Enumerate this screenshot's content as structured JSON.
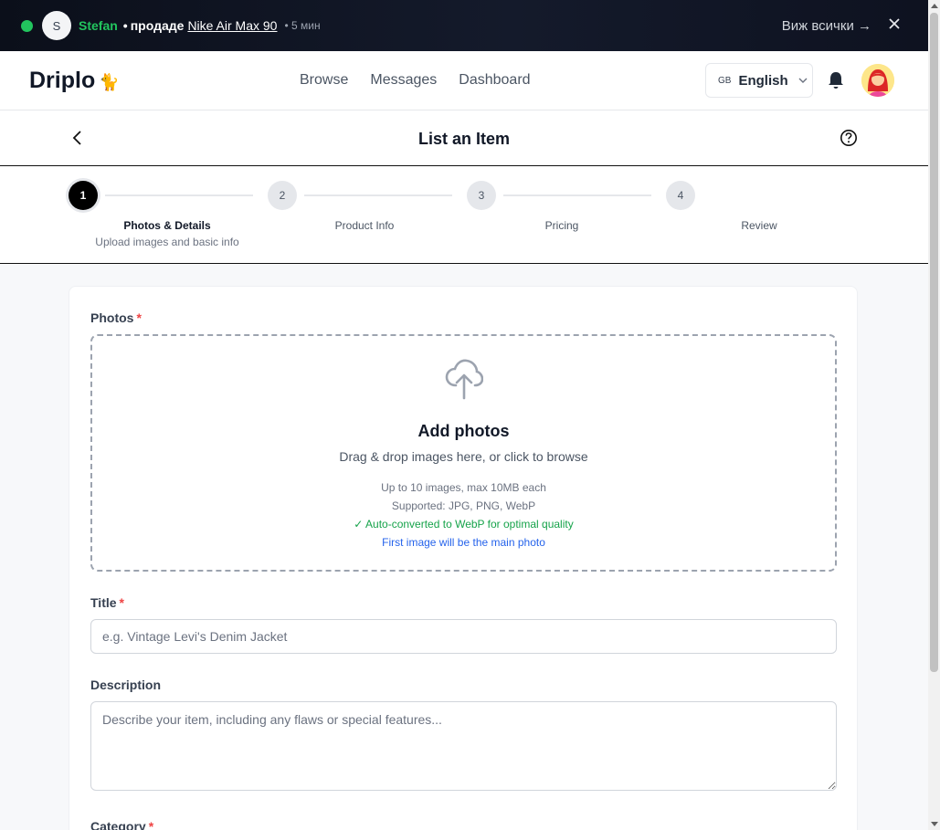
{
  "notification": {
    "avatar_letter": "S",
    "user": "Stefan",
    "separator": "•",
    "verb": "продаде",
    "item": "Nike Air Max 90",
    "time": "• 5 мин",
    "see_all": "Виж всички →",
    "close": "✕"
  },
  "header": {
    "logo": "Driplo",
    "logo_emoji": "🐈",
    "nav": [
      "Browse",
      "Messages",
      "Dashboard"
    ],
    "language_code": "GB",
    "language": "English"
  },
  "page": {
    "title": "List an Item"
  },
  "stepper": {
    "steps": [
      {
        "number": "1",
        "label": "Photos & Details",
        "sub": "Upload images and basic info"
      },
      {
        "number": "2",
        "label": "Product Info"
      },
      {
        "number": "3",
        "label": "Pricing"
      },
      {
        "number": "4",
        "label": "Review"
      }
    ],
    "current_step": 1
  },
  "form": {
    "photos": {
      "label": "Photos",
      "required_mark": "*",
      "dropzone_title": "Add photos",
      "dropzone_sub": "Drag & drop images here, or click to browse",
      "limits": "Up to 10 images, max 10MB each",
      "supported": "Supported: JPG, PNG, WebP",
      "webp_note": "✓ Auto-converted to WebP for optimal quality",
      "main_photo_note": "First image will be the main photo"
    },
    "title": {
      "label": "Title",
      "required_mark": "*",
      "placeholder": "e.g. Vintage Levi's Denim Jacket",
      "value": ""
    },
    "description": {
      "label": "Description",
      "placeholder": "Describe your item, including any flaws or special features...",
      "value": ""
    },
    "category": {
      "label": "Category",
      "required_mark": "*"
    }
  },
  "colors": {
    "accent_green": "#22c55e",
    "required_red": "#ef4444",
    "info_blue": "#2563eb",
    "success_green": "#16a34a"
  }
}
